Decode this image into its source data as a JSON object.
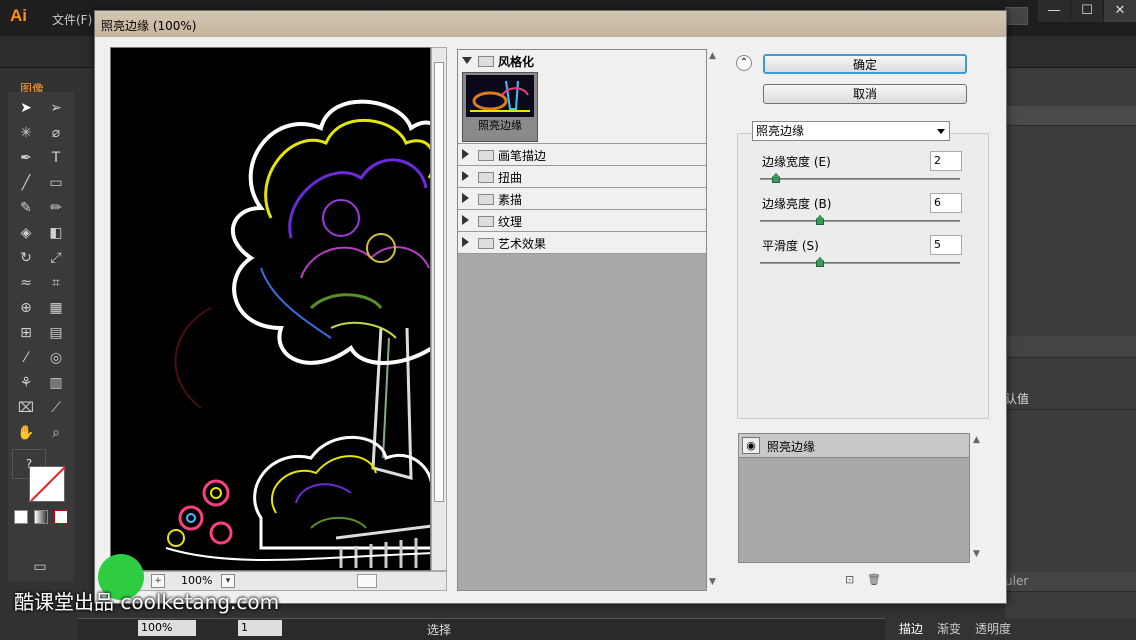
{
  "app": {
    "logo": "Ai",
    "menu_file": "文件(F)",
    "control_label": "图像",
    "win_minimize": "—",
    "win_maximize": "☐",
    "win_close": "✕",
    "panel_text_value": "认值",
    "panel_text_ruler": "uler"
  },
  "statusbar": {
    "zoom": "100%",
    "page": "1",
    "current_tool": "选择"
  },
  "bottom_tabs": [
    "描边",
    "渐变",
    "透明度"
  ],
  "dialog": {
    "title": "照亮边缘 (100%)",
    "preview_zoom": "100%",
    "buttons": {
      "ok": "确定",
      "cancel": "取消"
    },
    "gallery": {
      "open_category": "风格化",
      "selected_filter": "照亮边缘",
      "categories": [
        "画笔描边",
        "扭曲",
        "素描",
        "纹理",
        "艺术效果"
      ]
    },
    "settings": {
      "filter_select": "照亮边缘",
      "params": [
        {
          "label": "边缘宽度 (E)",
          "value": "2",
          "fraction": 0.08
        },
        {
          "label": "边缘亮度 (B)",
          "value": "6",
          "fraction": 0.3
        },
        {
          "label": "平滑度 (S)",
          "value": "5",
          "fraction": 0.3
        }
      ]
    },
    "effect_layer": "照亮边缘"
  },
  "colors": {
    "accent": "#ff8c1a",
    "focus": "#3c9ad8",
    "slider_thumb": "#3a9a5a",
    "watermark_badge": "#2ecc40"
  },
  "watermark": "酷课堂出品 coolketang.com"
}
